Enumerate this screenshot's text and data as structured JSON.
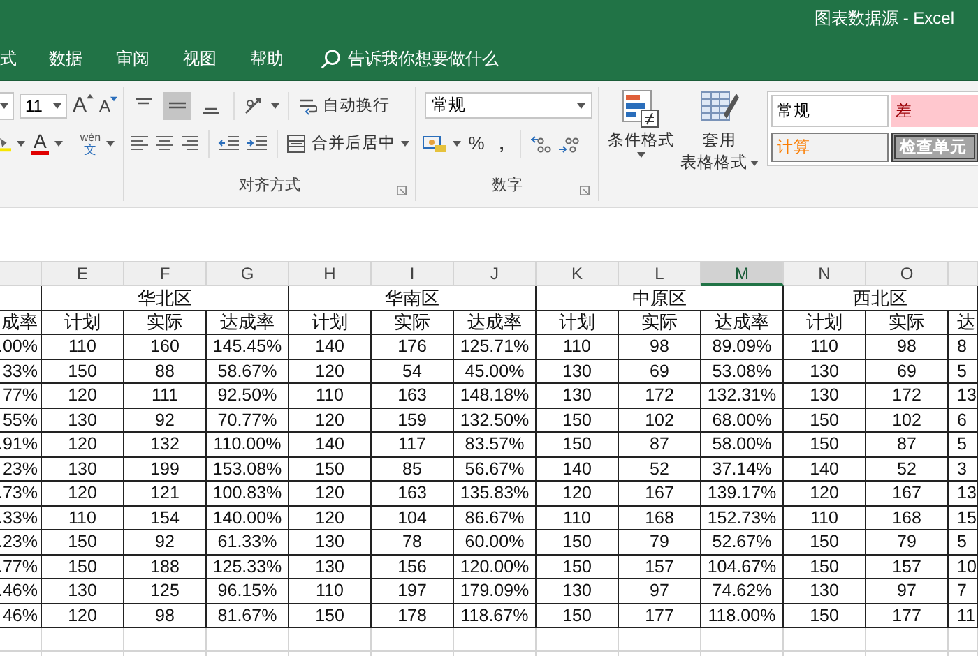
{
  "window": {
    "title": "图表数据源 - Excel"
  },
  "menu": {
    "tabs": [
      {
        "label": "式"
      },
      {
        "label": "数据"
      },
      {
        "label": "审阅"
      },
      {
        "label": "视图"
      },
      {
        "label": "帮助"
      }
    ],
    "tell_me": {
      "placeholder": "告诉我你想要做什么"
    }
  },
  "ribbon": {
    "font": {
      "size": "11",
      "grow": "A",
      "shrink": "A",
      "tint_letter": "A",
      "phonetic_top": "wén",
      "phonetic_bottom": "文"
    },
    "alignment": {
      "vertical": [
        {
          "kind": "top",
          "selected": false
        },
        {
          "kind": "middle",
          "selected": true
        },
        {
          "kind": "bottom",
          "selected": false
        }
      ],
      "wrap": "自动换行",
      "merge": "合并后居中",
      "label": "对齐方式"
    },
    "number": {
      "format": "常规",
      "percent": "%",
      "comma": ",",
      "label": "数字"
    },
    "styles": {
      "conditional": "条件格式",
      "table_top": "套用",
      "table_bottom": "表格格式",
      "gallery": [
        {
          "label": "常规",
          "kind": "normal"
        },
        {
          "label": "差",
          "kind": "bad"
        },
        {
          "label": "计算",
          "kind": "calculation"
        },
        {
          "label": "检查单元",
          "kind": "check"
        }
      ]
    }
  },
  "sheet": {
    "columns": [
      {
        "selected": false
      },
      {
        "letter": "E",
        "selected": false
      },
      {
        "letter": "F",
        "selected": false
      },
      {
        "letter": "G",
        "selected": false
      },
      {
        "letter": "H",
        "selected": false
      },
      {
        "letter": "I",
        "selected": false
      },
      {
        "letter": "J",
        "selected": false
      },
      {
        "letter": "K",
        "selected": false
      },
      {
        "letter": "L",
        "selected": false
      },
      {
        "letter": "M",
        "selected": true
      },
      {
        "letter": "N",
        "selected": false
      },
      {
        "letter": "O",
        "selected": false
      },
      {
        "selected": false
      }
    ],
    "groups": [
      "华北区",
      "华南区",
      "中原区",
      "西北区"
    ],
    "subheaders": [
      "成率",
      "计划",
      "实际",
      "达成率",
      "计划",
      "实际",
      "达成率",
      "计划",
      "实际",
      "达成率",
      "计划",
      "实际",
      "达"
    ],
    "rows": [
      [
        ".00%",
        "110",
        "160",
        "145.45%",
        "140",
        "176",
        "125.71%",
        "110",
        "98",
        "89.09%",
        "110",
        "98",
        "8"
      ],
      [
        "33%",
        "150",
        "88",
        "58.67%",
        "120",
        "54",
        "45.00%",
        "130",
        "69",
        "53.08%",
        "130",
        "69",
        "5"
      ],
      [
        "77%",
        "120",
        "111",
        "92.50%",
        "110",
        "163",
        "148.18%",
        "130",
        "172",
        "132.31%",
        "130",
        "172",
        "13"
      ],
      [
        "55%",
        "130",
        "92",
        "70.77%",
        "120",
        "159",
        "132.50%",
        "150",
        "102",
        "68.00%",
        "150",
        "102",
        "6"
      ],
      [
        ".91%",
        "120",
        "132",
        "110.00%",
        "140",
        "117",
        "83.57%",
        "150",
        "87",
        "58.00%",
        "150",
        "87",
        "5"
      ],
      [
        "23%",
        "130",
        "199",
        "153.08%",
        "150",
        "85",
        "56.67%",
        "140",
        "52",
        "37.14%",
        "140",
        "52",
        "3"
      ],
      [
        ".73%",
        "120",
        "121",
        "100.83%",
        "120",
        "163",
        "135.83%",
        "120",
        "167",
        "139.17%",
        "120",
        "167",
        "13"
      ],
      [
        ".33%",
        "110",
        "154",
        "140.00%",
        "120",
        "104",
        "86.67%",
        "110",
        "168",
        "152.73%",
        "110",
        "168",
        "15"
      ],
      [
        ".23%",
        "150",
        "92",
        "61.33%",
        "130",
        "78",
        "60.00%",
        "150",
        "79",
        "52.67%",
        "150",
        "79",
        "5"
      ],
      [
        ".77%",
        "150",
        "188",
        "125.33%",
        "130",
        "156",
        "120.00%",
        "150",
        "157",
        "104.67%",
        "150",
        "157",
        "10"
      ],
      [
        ".46%",
        "130",
        "125",
        "96.15%",
        "110",
        "197",
        "179.09%",
        "130",
        "97",
        "74.62%",
        "130",
        "97",
        "7"
      ],
      [
        "46%",
        "120",
        "98",
        "81.67%",
        "150",
        "178",
        "118.67%",
        "150",
        "177",
        "118.00%",
        "150",
        "177",
        "11"
      ]
    ]
  }
}
